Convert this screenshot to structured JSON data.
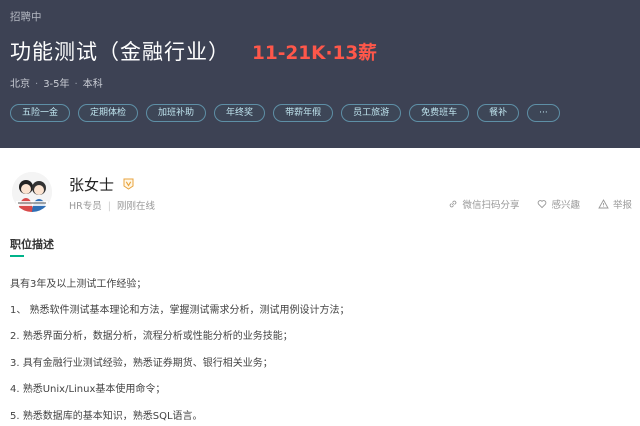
{
  "header": {
    "status": "招聘中",
    "job_title": "功能测试（金融行业）",
    "salary": "11-21K·13薪",
    "meta": {
      "city": "北京",
      "experience": "3-5年",
      "education": "本科",
      "separator": "·"
    },
    "tags": [
      "五险一金",
      "定期体检",
      "加班补助",
      "年终奖",
      "带薪年假",
      "员工旅游",
      "免费班车",
      "餐补",
      "···"
    ]
  },
  "recruiter": {
    "name": "张女士",
    "role": "HR专员",
    "online_status": "刚刚在线",
    "avatar_icon": "cartoon-avatar-icon",
    "verified_icon": "verified-badge-icon",
    "accent_color": "#e8a33d"
  },
  "actions": {
    "share": "微信扫码分享",
    "interest": "感兴趣",
    "report": "举报"
  },
  "description": {
    "title": "职位描述",
    "lines": [
      "具有3年及以上测试工作经验；",
      "1、 熟悉软件测试基本理论和方法，掌握测试需求分析，测试用例设计方法；",
      "2. 熟悉界面分析，数据分析，流程分析或性能分析的业务技能；",
      "3. 具有金融行业测试经验，熟悉证券期货、银行相关业务；",
      "4. 熟悉Unix/Linux基本使用命令；",
      "5. 熟悉数据库的基本知识，熟悉SQL语言。"
    ]
  },
  "colors": {
    "header_bg": "#3d4254",
    "salary": "#fe574a",
    "section_accent": "#00b38a"
  }
}
